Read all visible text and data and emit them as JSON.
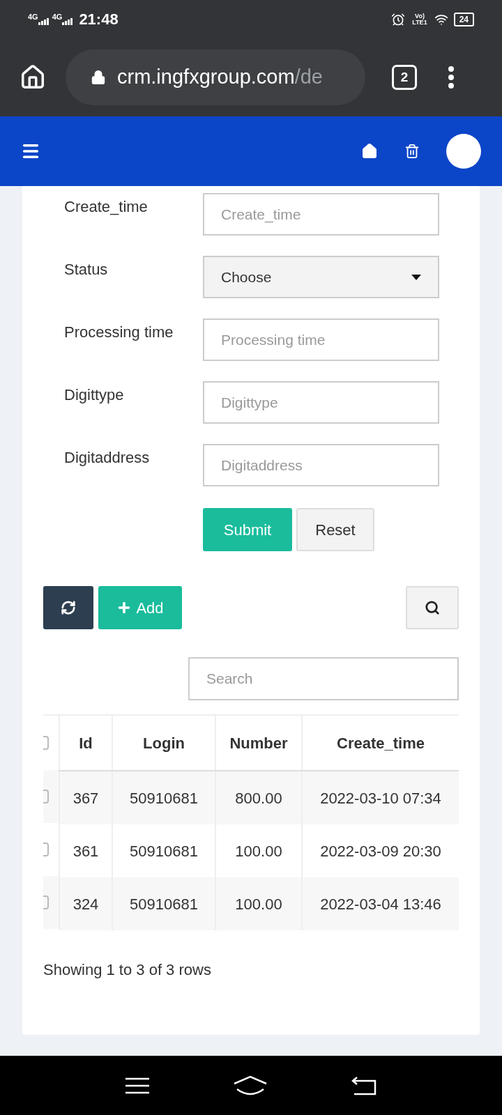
{
  "status_bar": {
    "network": [
      "4G",
      "4G"
    ],
    "time": "21:48",
    "volte_top": "Vo)",
    "volte_bottom": "LTE1",
    "battery": "24"
  },
  "browser": {
    "url_host": "crm.ingfxgroup.com",
    "url_path": "/de",
    "tab_count": "2"
  },
  "form": {
    "fields": [
      {
        "label": "Create_time",
        "kind": "text",
        "placeholder": "Create_time"
      },
      {
        "label": "Status",
        "kind": "select",
        "value": "Choose"
      },
      {
        "label": "Processing time",
        "kind": "text",
        "placeholder": "Processing time"
      },
      {
        "label": "Digittype",
        "kind": "text",
        "placeholder": "Digittype"
      },
      {
        "label": "Digitaddress",
        "kind": "text",
        "placeholder": "Digitaddress"
      }
    ],
    "submit": "Submit",
    "reset": "Reset"
  },
  "toolbar": {
    "add": "Add",
    "search_placeholder": "Search"
  },
  "table": {
    "select_all_checked": false,
    "columns": [
      "Id",
      "Login",
      "Number",
      "Create_time"
    ],
    "rows": [
      {
        "checked": false,
        "cells": [
          "367",
          "50910681",
          "800.00",
          "2022-03-10 07:34"
        ]
      },
      {
        "checked": false,
        "cells": [
          "361",
          "50910681",
          "100.00",
          "2022-03-09 20:30"
        ]
      },
      {
        "checked": false,
        "cells": [
          "324",
          "50910681",
          "100.00",
          "2022-03-04 13:46"
        ]
      }
    ]
  },
  "pagination": "Showing 1 to 3 of 3 rows"
}
